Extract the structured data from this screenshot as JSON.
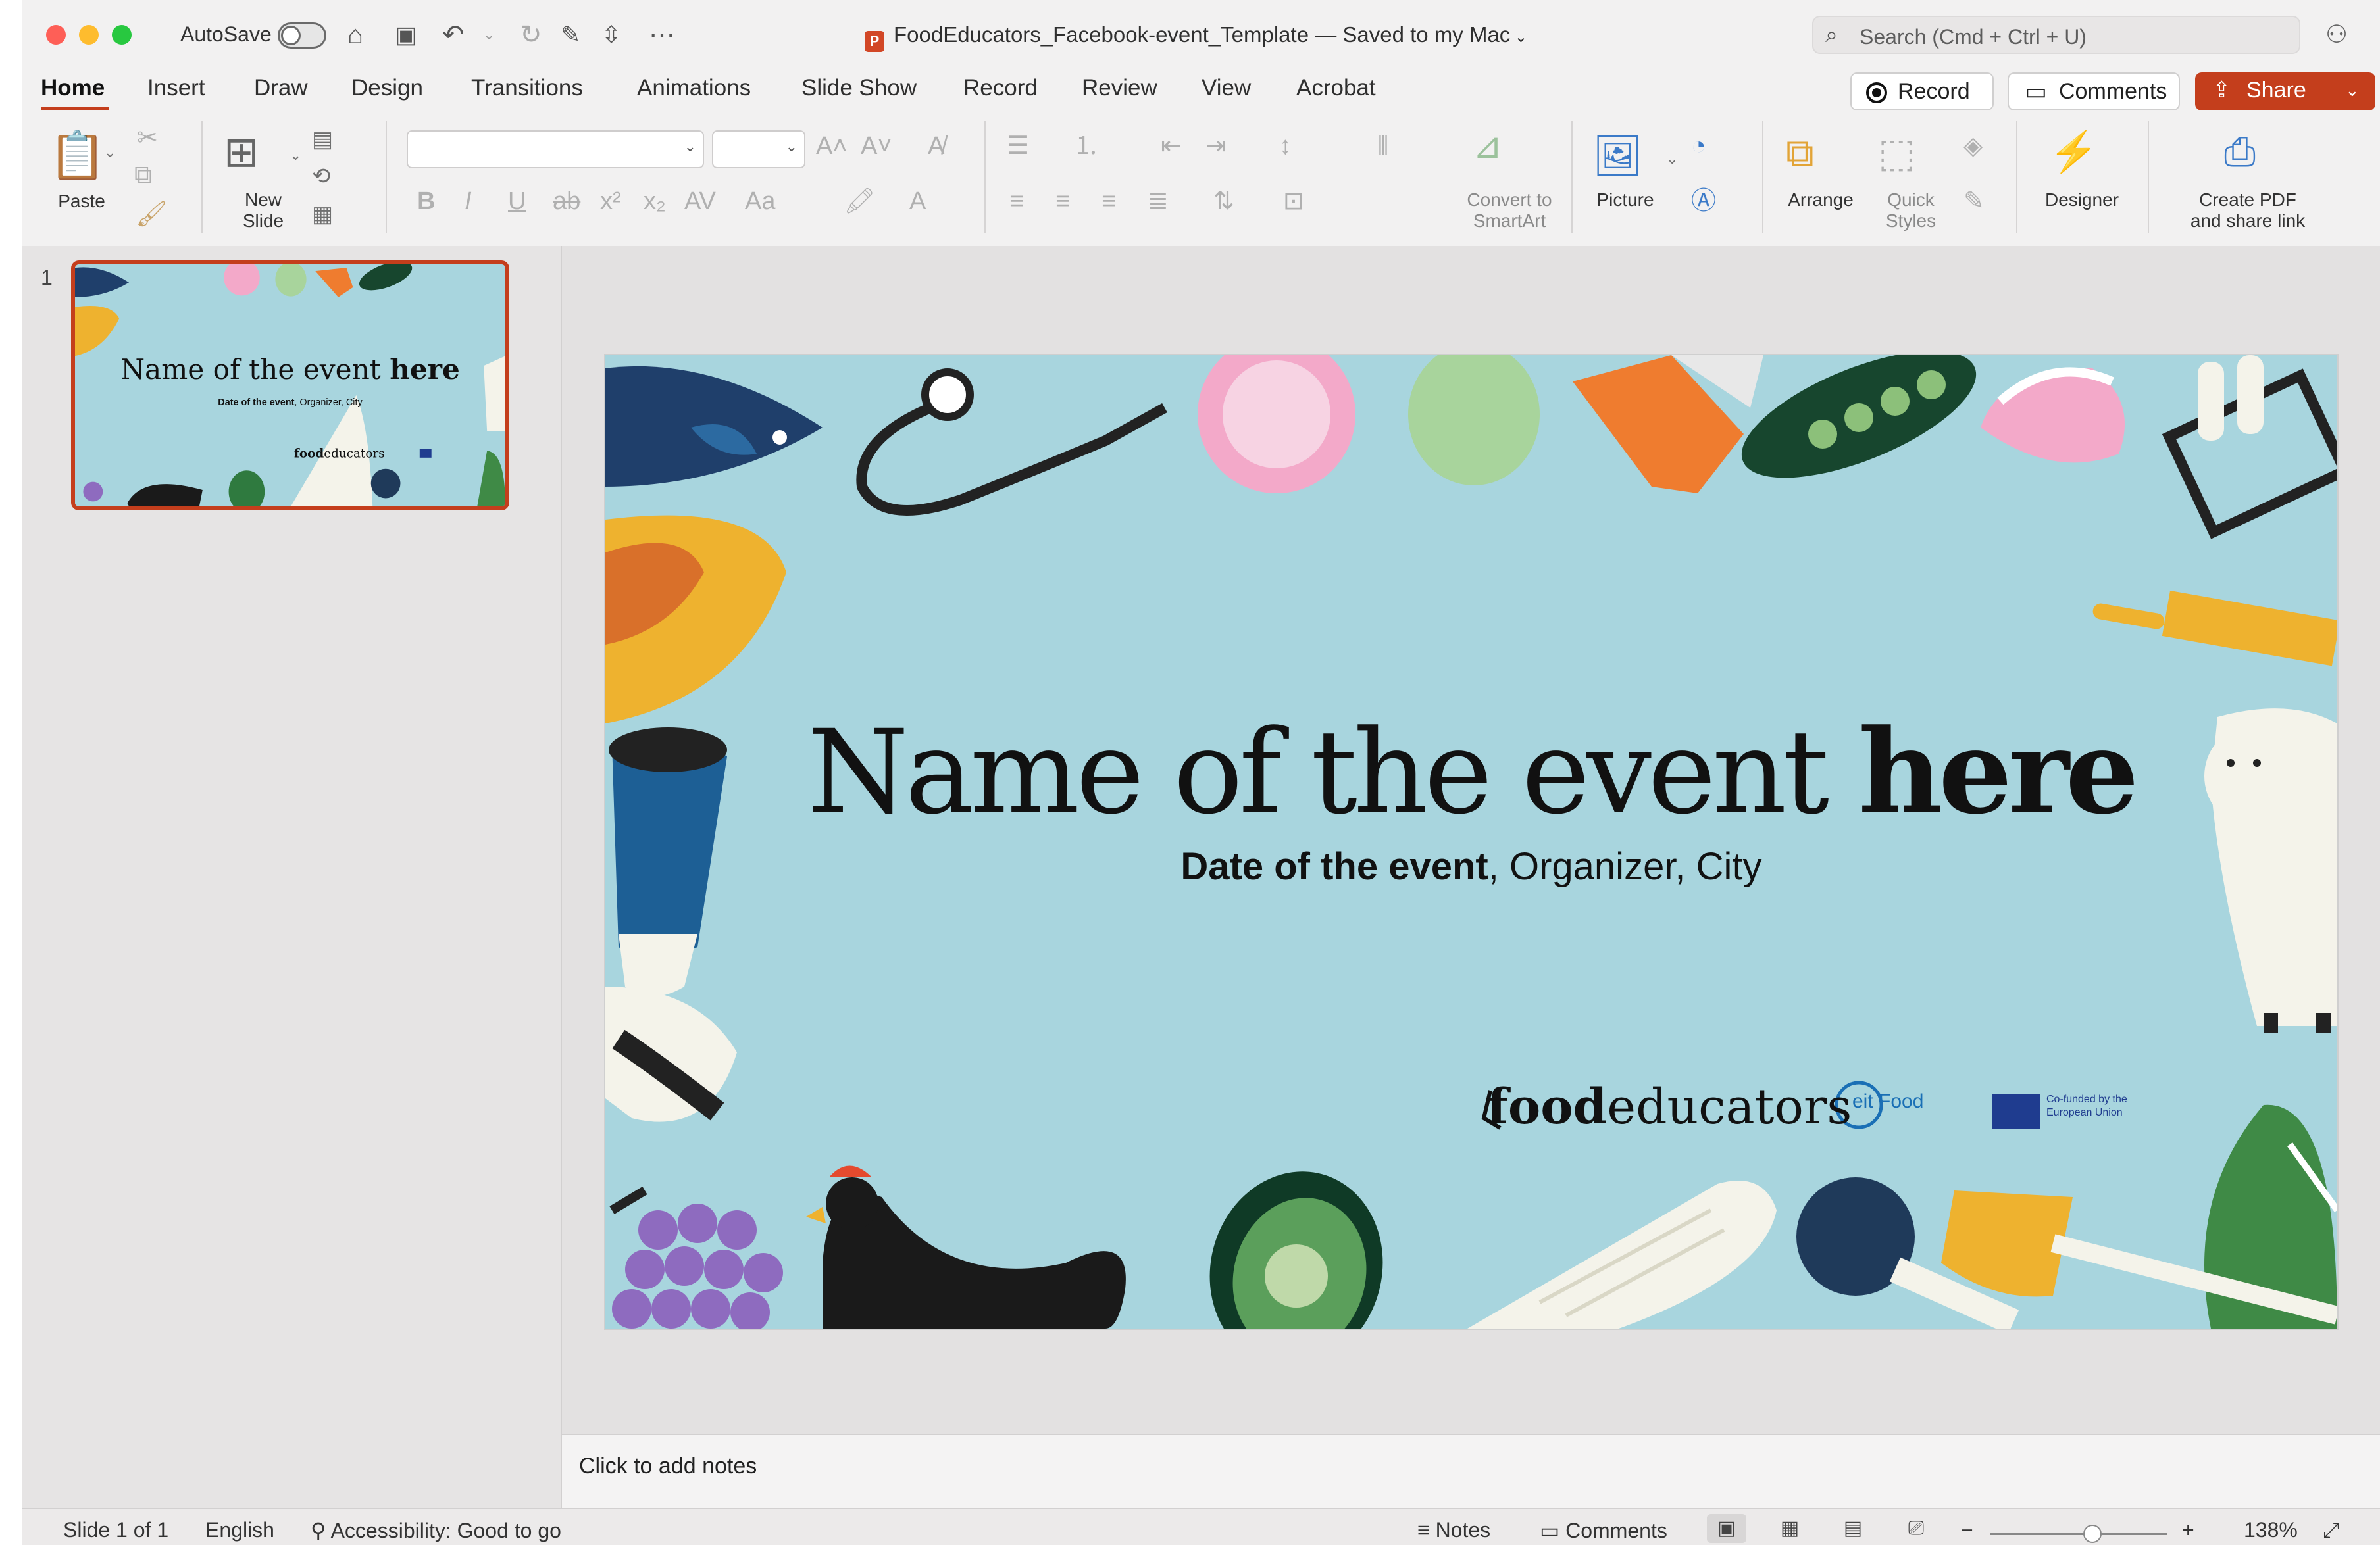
{
  "window": {
    "autosave_label": "AutoSave",
    "document_title": "FoodEducators_Facebook-event_Template — Saved to my Mac",
    "search_placeholder": "Search (Cmd + Ctrl + U)"
  },
  "tabs": [
    "Home",
    "Insert",
    "Draw",
    "Design",
    "Transitions",
    "Animations",
    "Slide Show",
    "Record",
    "Review",
    "View",
    "Acrobat"
  ],
  "tab_actions": {
    "record": "Record",
    "comments": "Comments",
    "share": "Share"
  },
  "ribbon": {
    "paste": "Paste",
    "new_slide": "New\nSlide",
    "convert_smartart": "Convert to\nSmartArt",
    "picture": "Picture",
    "arrange": "Arrange",
    "quick_styles": "Quick\nStyles",
    "designer": "Designer",
    "create_pdf": "Create PDF\nand share link"
  },
  "slides_pane": {
    "slide_number": "1"
  },
  "slide": {
    "title_regular": "Name of the event ",
    "title_bold": "here",
    "subtitle_bold": "Date of the event",
    "subtitle_rest": ", Organizer, City",
    "logo_food_bold": "food",
    "logo_food_rest": "educators",
    "logo_eit": "eit Food",
    "eu_text": "Co-funded by the European Union",
    "background_color": "#a8d5de"
  },
  "notes": {
    "placeholder": "Click to add notes"
  },
  "statusbar": {
    "slide_info": "Slide 1 of 1",
    "language": "English",
    "accessibility": "Accessibility: Good to go",
    "notes": "Notes",
    "comments": "Comments",
    "zoom": "138%"
  },
  "colors": {
    "accent": "#c43e1c",
    "slide_bg": "#a8d5de"
  }
}
